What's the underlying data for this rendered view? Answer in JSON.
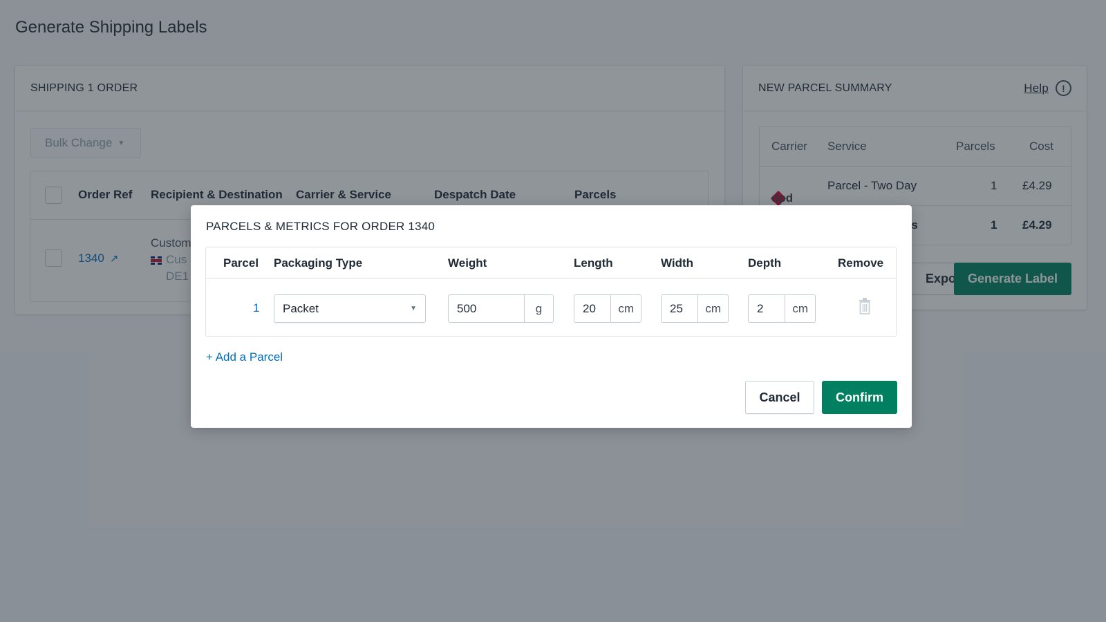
{
  "page": {
    "title": "Generate Shipping Labels"
  },
  "orders_card": {
    "heading": "SHIPPING 1 ORDER",
    "bulk_change_label": "Bulk Change",
    "columns": [
      "Order Ref",
      "Recipient & Destination",
      "Carrier & Service",
      "Despatch Date",
      "Parcels"
    ],
    "rows": [
      {
        "order_ref": "1340",
        "recipient_line1": "Custom",
        "recipient_line2": "Cus",
        "recipient_line3": "DE1"
      }
    ]
  },
  "summary_card": {
    "heading": "NEW PARCEL SUMMARY",
    "help_label": "Help",
    "columns": [
      "Carrier",
      "Service",
      "Parcels",
      "Cost"
    ],
    "rows": [
      {
        "carrier": "dpd",
        "service": "Parcel - Two Day",
        "parcels": "1",
        "cost": "£4.29"
      }
    ],
    "totals": {
      "label": "Totals",
      "parcels": "1",
      "cost": "£4.29"
    },
    "export_label": "Export",
    "generate_label": "Generate Label"
  },
  "modal": {
    "title": "PARCELS & METRICS FOR ORDER 1340",
    "columns": [
      "Parcel",
      "Packaging Type",
      "Weight",
      "Length",
      "Width",
      "Depth",
      "Remove"
    ],
    "parcels": [
      {
        "number": "1",
        "packaging_type": "Packet",
        "weight": "500",
        "weight_unit": "g",
        "length": "20",
        "length_unit": "cm",
        "width": "25",
        "width_unit": "cm",
        "depth": "2",
        "depth_unit": "cm"
      }
    ],
    "add_parcel_label": "+ Add a Parcel",
    "cancel_label": "Cancel",
    "confirm_label": "Confirm"
  },
  "colors": {
    "primary": "#008060",
    "link": "#006fbb",
    "dpd": "#dc0032"
  }
}
